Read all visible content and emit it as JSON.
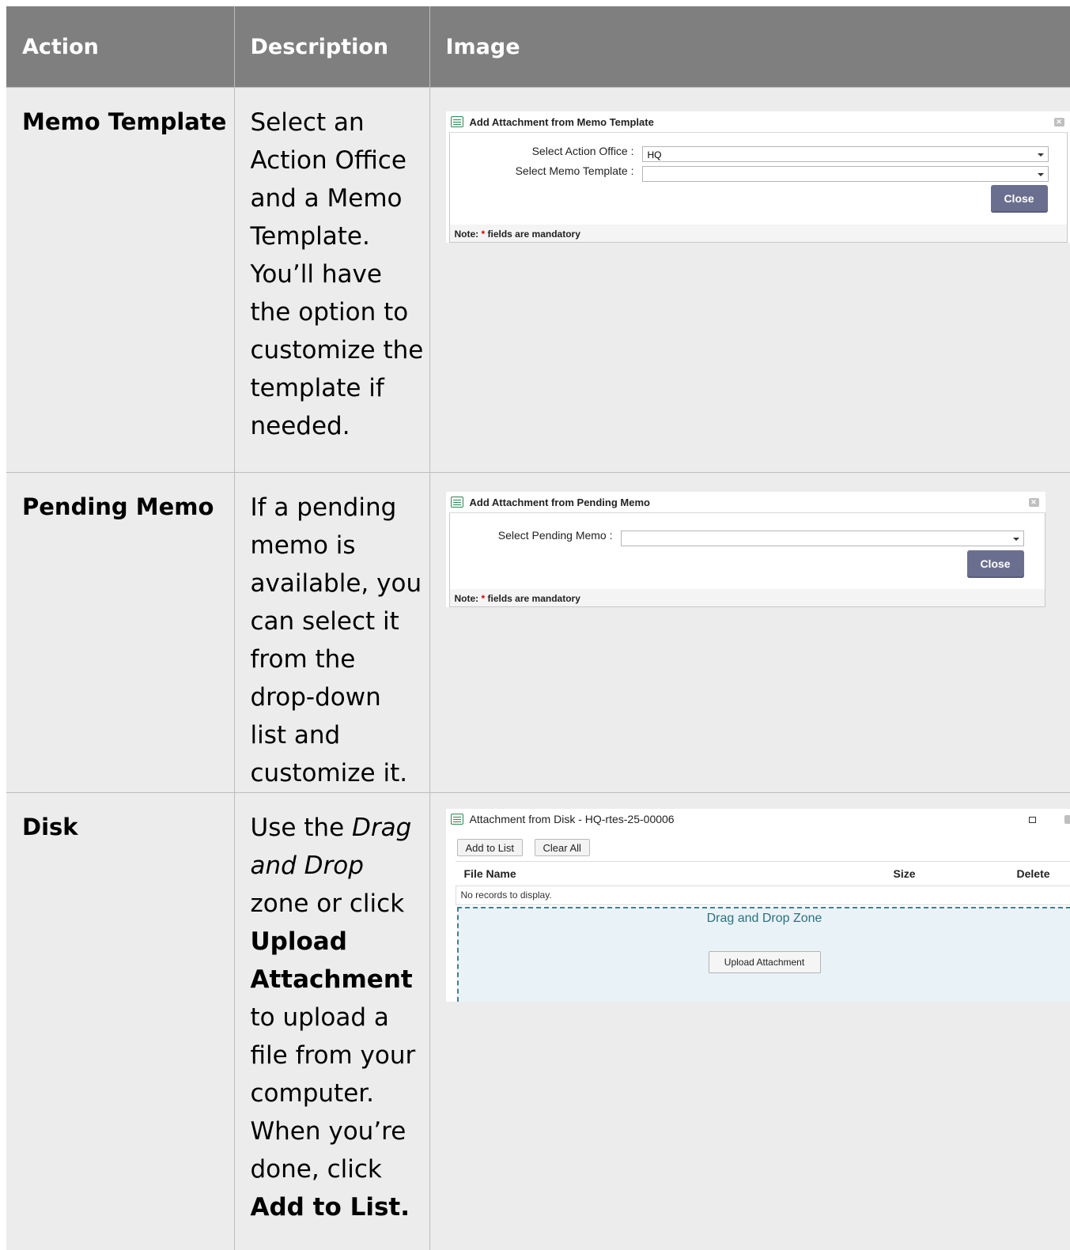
{
  "headers": {
    "action": "Action",
    "description": "Description",
    "image": "Image"
  },
  "rows": [
    {
      "action": "Memo Template",
      "description": "Select an Action Office and a Memo Template. You’ll have the option to customize the template if needed.",
      "dialog": {
        "title": "Add Attachment from Memo Template",
        "label_office": "Select Action Office :",
        "value_office": "HQ",
        "label_template": "Select Memo Template :",
        "value_template": "",
        "close": "Close",
        "note_prefix": "Note: ",
        "note_star": "*",
        "note_suffix": " fields are mandatory"
      }
    },
    {
      "action": "Pending Memo",
      "description": "If a pending memo is available, you can select it from the drop-down list and customize it.",
      "dialog": {
        "title": "Add Attachment from Pending Memo",
        "label_pending": "Select Pending Memo :",
        "value_pending": "",
        "close": "Close",
        "note_prefix": "Note: ",
        "note_star": "*",
        "note_suffix": " fields are mandatory"
      }
    },
    {
      "action": "Disk",
      "description_parts": {
        "p1": "Use the ",
        "i1": "Drag and Drop",
        "p2": " zone or click ",
        "b1": "Upload Attachment",
        "p3": " to upload a file from your computer. When you’re done, click ",
        "b2": "Add to List."
      },
      "dialog": {
        "title": "Attachment from Disk - HQ-rtes-25-00006",
        "add_to_list": "Add to List",
        "clear_all": "Clear All",
        "col_file": "File Name",
        "col_size": "Size",
        "col_delete": "Delete",
        "empty": "No records to display.",
        "dropzone": "Drag and Drop Zone",
        "upload": "Upload Attachment"
      }
    }
  ]
}
